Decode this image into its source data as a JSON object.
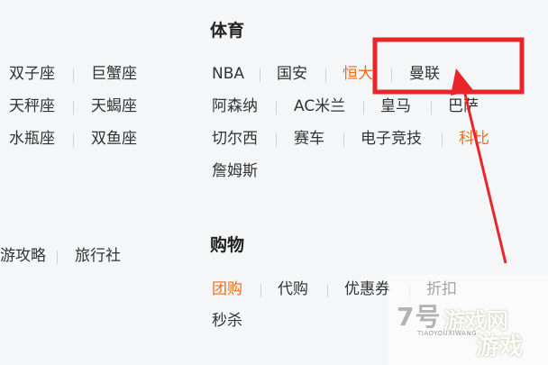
{
  "left_column": {
    "row1": [
      "双子座",
      "巨蟹座"
    ],
    "row2": [
      "天秤座",
      "天蝎座"
    ],
    "row3": [
      "水瓶座",
      "双鱼座"
    ],
    "travel": [
      "游攻略",
      "旅行社"
    ]
  },
  "sports": {
    "heading": "体育",
    "row1": [
      "NBA",
      "国安",
      "恒大",
      "曼联"
    ],
    "row2": [
      "阿森纳",
      "AC米兰",
      "皇马",
      "巴萨"
    ],
    "row3": [
      "切尔西",
      "赛车",
      "电子竞技",
      "科比"
    ],
    "row4": [
      "詹姆斯"
    ]
  },
  "shopping": {
    "heading": "购物",
    "row1": [
      "团购",
      "代购",
      "优惠券",
      "折扣"
    ],
    "row2": [
      "秒杀"
    ]
  },
  "highlight_color": "#f06d1a",
  "annotation_color": "#e8262a",
  "watermark": {
    "logo": "7号游戏网",
    "site": "TIAOYOUXIWANG",
    "tag": "游戏"
  }
}
